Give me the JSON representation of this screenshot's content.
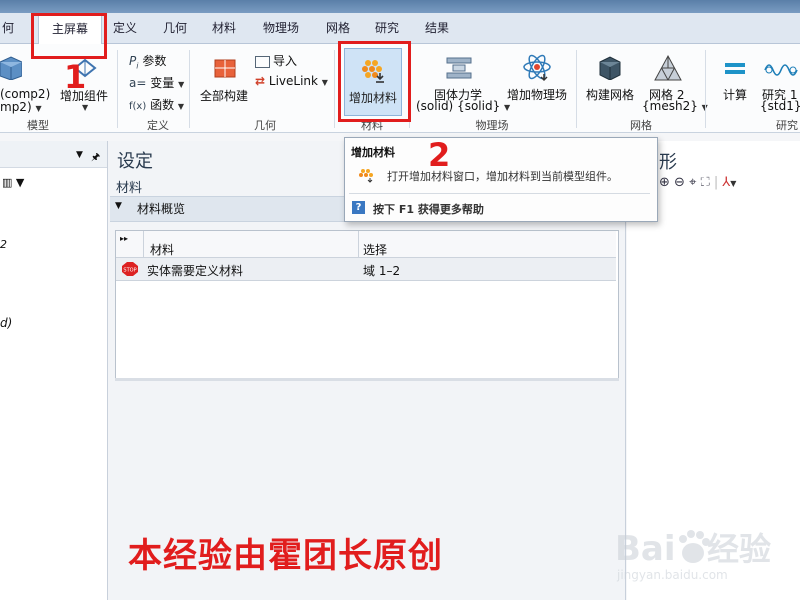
{
  "tabs": [
    {
      "label": "何",
      "active": false
    },
    {
      "label": "主屏幕",
      "active": true
    },
    {
      "label": "定义",
      "active": false
    },
    {
      "label": "几何",
      "active": false
    },
    {
      "label": "材料",
      "active": false
    },
    {
      "label": "物理场",
      "active": false
    },
    {
      "label": "网格",
      "active": false
    },
    {
      "label": "研究",
      "active": false
    },
    {
      "label": "结果",
      "active": false
    }
  ],
  "ribbon": {
    "model": {
      "comp_line1": "(comp2)",
      "comp_line2": "mp2)",
      "add_component": "增加组件",
      "group": "模型"
    },
    "definitions": {
      "param": "参数",
      "variable": "变量",
      "function": "函数",
      "group": "定义"
    },
    "geometry": {
      "build_all": "全部构建",
      "import": "导入",
      "livelink": "LiveLink",
      "group": "几何"
    },
    "materials": {
      "add_material": "增加材料",
      "group": "材料"
    },
    "physics": {
      "solid_line1": "固体力学",
      "solid_line2": "(solid) {solid}",
      "add_physics": "增加物理场",
      "group": "物理场"
    },
    "mesh": {
      "build_mesh": "构建网格",
      "mesh2_line1": "网格 2",
      "mesh2_line2": "{mesh2}",
      "group": "网格"
    },
    "study": {
      "compute": "计算",
      "study1_line1": "研究 1",
      "study1_line2": "{std1}",
      "group": "研究"
    }
  },
  "left_panel": {
    "frag1": "2",
    "frag2": "d)"
  },
  "settings": {
    "title": "设定",
    "subtitle": "材料",
    "section": "材料概览",
    "table": {
      "headers": [
        "材料",
        "选择"
      ],
      "rows": [
        {
          "status_icon": "stop-icon",
          "material": "实体需要定义材料",
          "selection": "域 1–2"
        }
      ]
    }
  },
  "tooltip": {
    "title": "增加材料",
    "desc": "打开增加材料窗口，增加材料到当前模型组件。",
    "help": "按下 F1 获得更多帮助"
  },
  "right_panel": {
    "title": "形"
  },
  "annotations": {
    "n1": "1",
    "n2": "2",
    "watermark": "本经验由霍团长原创"
  },
  "baidu": {
    "logo": "Bai du 经验",
    "url": "jingyan.baidu.com"
  },
  "colors": {
    "annotation_red": "#e11d1d",
    "ribbon_bg": "#fbfcfd",
    "selected_button": "#cfe3f6"
  }
}
